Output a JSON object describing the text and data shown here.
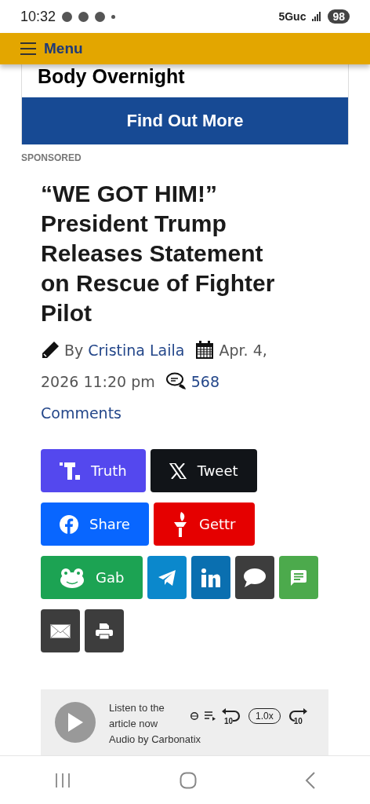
{
  "status_bar": {
    "time": "10:32",
    "network": "5Guc",
    "battery": "98"
  },
  "menu_bar": {
    "label": "Menu"
  },
  "ad": {
    "title": "Body Overnight",
    "button": "Find Out More"
  },
  "sponsored": "SPONSORED",
  "article": {
    "headline": "“WE GOT HIM!” President Trump Releases Statement on Rescue of Fighter Pilot",
    "by": "By",
    "author": "Cristina Laila",
    "date": [
      "Apr. 4,",
      "2026 11:20 pm"
    ],
    "comment_count": "568",
    "comments": "Comments"
  },
  "share_rows": [
    [
      {
        "kind": "truth",
        "label": "Truth",
        "color": "#5448ee"
      },
      {
        "kind": "x",
        "label": "Tweet",
        "color": "#111418"
      }
    ],
    [
      {
        "kind": "facebook",
        "label": "Share",
        "color": "#0866ff"
      },
      {
        "kind": "gettr",
        "label": "Gettr",
        "color": "#e50000"
      }
    ],
    [
      {
        "kind": "gab",
        "label": "Gab",
        "color": "#1ca353"
      },
      {
        "kind": "telegram",
        "color": "#0b88cc"
      },
      {
        "kind": "linkedin",
        "color": "#0a6fb0"
      },
      {
        "kind": "comment",
        "color": "#3d3d3d"
      },
      {
        "kind": "sms",
        "color": "#4caa4c"
      }
    ],
    [
      {
        "kind": "email",
        "color": "#3d3d3d"
      },
      {
        "kind": "print",
        "color": "#3d3d3d"
      }
    ]
  ],
  "audio_player": {
    "line_1": "Listen to the",
    "line_2": "article now",
    "credit": "Audio by Carbonatix",
    "skip_back": "10",
    "speed": "1.0x",
    "skip_forward": "10"
  }
}
